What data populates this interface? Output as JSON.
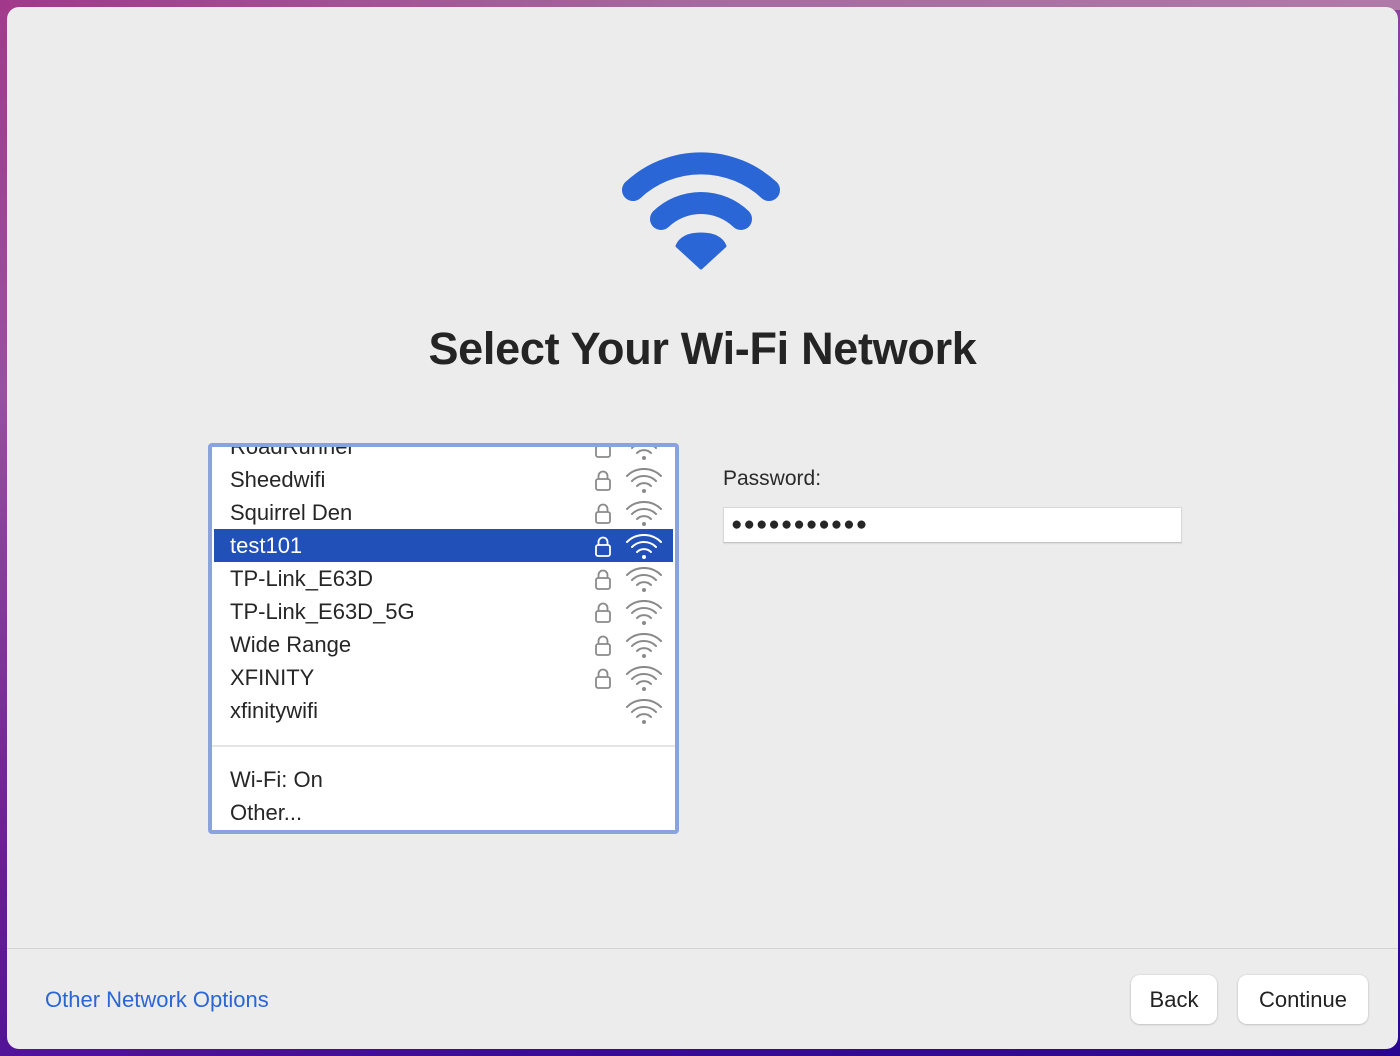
{
  "page": {
    "title": "Select Your Wi-Fi Network",
    "hero_icon": "wifi-icon",
    "accent_color": "#2a66d6",
    "selection_color": "#2150b9"
  },
  "network_list": {
    "networks": [
      {
        "name": "RoadRunner",
        "secured": true,
        "icon": "wifi-signal-icon",
        "partially_visible": true
      },
      {
        "name": "Sheedwifi",
        "secured": true,
        "icon": "wifi-signal-icon"
      },
      {
        "name": "Squirrel Den",
        "secured": true,
        "icon": "wifi-signal-icon"
      },
      {
        "name": "test101",
        "secured": true,
        "icon": "wifi-signal-icon",
        "selected": true
      },
      {
        "name": "TP-Link_E63D",
        "secured": true,
        "icon": "wifi-signal-icon"
      },
      {
        "name": "TP-Link_E63D_5G",
        "secured": true,
        "icon": "wifi-signal-icon"
      },
      {
        "name": "Wide Range",
        "secured": true,
        "icon": "wifi-signal-icon"
      },
      {
        "name": "XFINITY",
        "secured": true,
        "icon": "wifi-signal-icon"
      },
      {
        "name": "xfinitywifi",
        "secured": false,
        "icon": "wifi-signal-icon"
      }
    ],
    "footer_items": [
      {
        "label": "Wi-Fi: On"
      },
      {
        "label": "Other..."
      }
    ]
  },
  "password": {
    "label": "Password:",
    "value": "●●●●●●●●●●●"
  },
  "footer": {
    "other_options_link": "Other Network Options",
    "back_label": "Back",
    "continue_label": "Continue"
  }
}
